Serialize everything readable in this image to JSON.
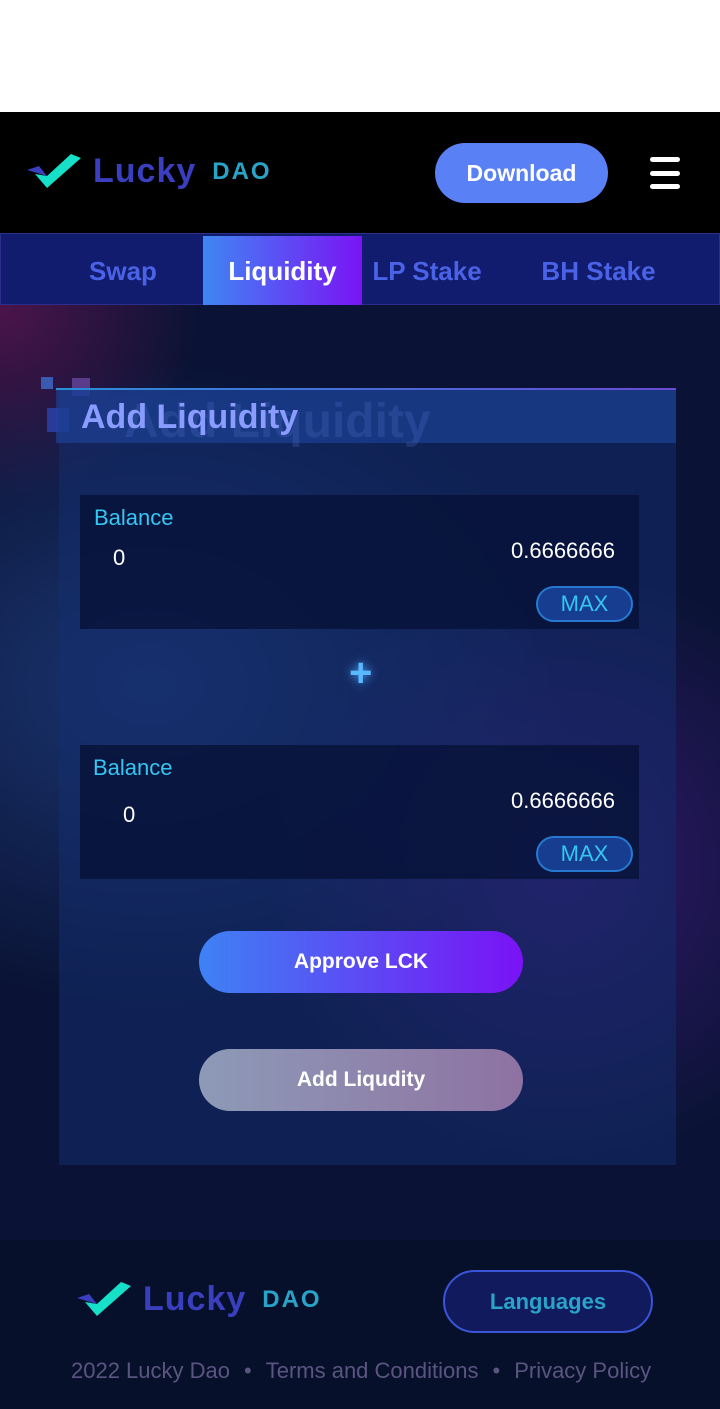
{
  "header": {
    "logo_word": "Lucky",
    "logo_dao": "DAO",
    "download_label": "Download"
  },
  "tabs": [
    {
      "label": "Swap"
    },
    {
      "label": "Liquidity",
      "active": true
    },
    {
      "label": "LP Stake"
    },
    {
      "label": "BH Stake"
    }
  ],
  "card": {
    "title": "Add Liquidity",
    "inputs": [
      {
        "label": "Balance",
        "value": "0",
        "balance": "0.6666666",
        "max_label": "MAX"
      },
      {
        "label": "Balance",
        "value": "0",
        "balance": "0.6666666",
        "max_label": "MAX"
      }
    ],
    "plus_icon": "+",
    "approve_label": "Approve LCK",
    "add_label": "Add Liqudity"
  },
  "footer": {
    "logo_word": "Lucky",
    "logo_dao": "DAO",
    "languages_label": "Languages",
    "copyright": "2022 Lucky Dao",
    "sep": "•",
    "terms": "Terms and Conditions",
    "privacy": "Privacy Policy"
  },
  "colors": {
    "accent": "#5a80f5",
    "tab_bg": "#111c6e",
    "cyan": "#35c6f2"
  }
}
